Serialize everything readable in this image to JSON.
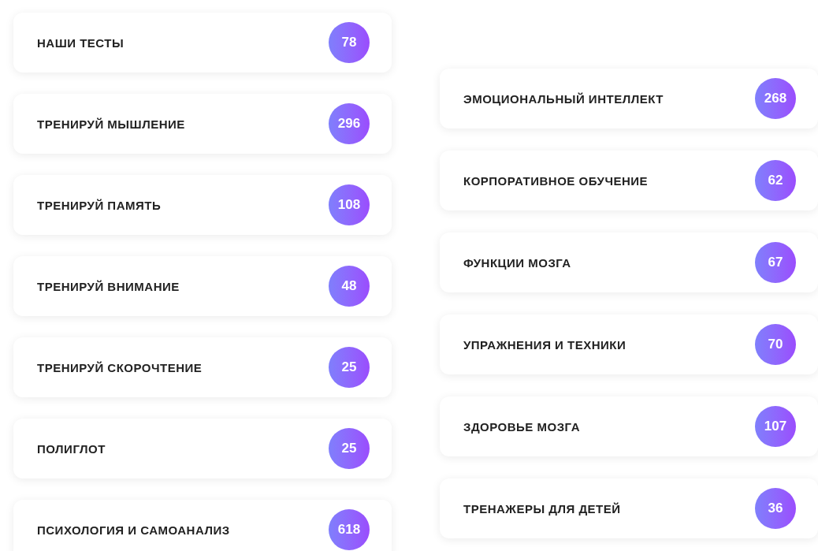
{
  "left_column": [
    {
      "label": "НАШИ ТЕСТЫ",
      "count": "78"
    },
    {
      "label": "ТРЕНИРУЙ МЫШЛЕНИЕ",
      "count": "296"
    },
    {
      "label": "ТРЕНИРУЙ ПАМЯТЬ",
      "count": "108"
    },
    {
      "label": "ТРЕНИРУЙ ВНИМАНИЕ",
      "count": "48"
    },
    {
      "label": "ТРЕНИРУЙ СКОРОЧТЕНИЕ",
      "count": "25"
    },
    {
      "label": "ПОЛИГЛОТ",
      "count": "25"
    },
    {
      "label": "ПСИХОЛОГИЯ И САМОАНАЛИЗ",
      "count": "618"
    }
  ],
  "right_column": [
    {
      "label": "ЭМОЦИОНАЛЬНЫЙ ИНТЕЛЛЕКТ",
      "count": "268"
    },
    {
      "label": "КОРПОРАТИВНОЕ ОБУЧЕНИЕ",
      "count": "62"
    },
    {
      "label": "ФУНКЦИИ МОЗГА",
      "count": "67"
    },
    {
      "label": "УПРАЖНЕНИЯ И ТЕХНИКИ",
      "count": "70"
    },
    {
      "label": "ЗДОРОВЬЕ МОЗГА",
      "count": "107"
    },
    {
      "label": "ТРЕНАЖЕРЫ ДЛЯ ДЕТЕЙ",
      "count": "36"
    }
  ]
}
